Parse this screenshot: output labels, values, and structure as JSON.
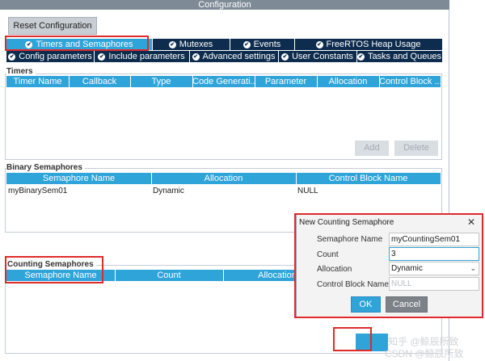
{
  "window": {
    "title": "Configuration"
  },
  "toolbar": {
    "reset_label": "Reset Configuration"
  },
  "tabs_row1": [
    {
      "label": "Timers and Semaphores",
      "active": true
    },
    {
      "label": "Mutexes"
    },
    {
      "label": "Events"
    },
    {
      "label": "FreeRTOS Heap Usage"
    }
  ],
  "tabs_row2": [
    {
      "label": "Config parameters"
    },
    {
      "label": "Include parameters"
    },
    {
      "label": "Advanced settings"
    },
    {
      "label": "User Constants"
    },
    {
      "label": "Tasks and Queues"
    }
  ],
  "timers": {
    "section_label": "Timers",
    "columns": [
      "Timer Name",
      "Callback",
      "Type",
      "Code Generati...",
      "Parameter",
      "Allocation",
      "Control Block ..."
    ],
    "add_label": "Add",
    "delete_label": "Delete"
  },
  "binary": {
    "section_label": "Binary Semaphores",
    "columns": [
      "Semaphore Name",
      "Allocation",
      "Control Block Name"
    ],
    "rows": [
      [
        "myBinarySem01",
        "Dynamic",
        "NULL"
      ]
    ]
  },
  "counting": {
    "section_label": "Counting Semaphores",
    "columns": [
      "Semaphore Name",
      "Count",
      "Allocation"
    ]
  },
  "dialog": {
    "title": "New Counting Semaphore",
    "close_glyph": "✕",
    "fields": [
      {
        "label": "Semaphore Name",
        "value": "myCountingSem01"
      },
      {
        "label": "Count",
        "value": "3"
      },
      {
        "label": "Allocation",
        "value": "Dynamic"
      },
      {
        "label": "Control Block Name",
        "placeholder": "NULL"
      }
    ],
    "ok_label": "OK",
    "cancel_label": "Cancel"
  },
  "watermark": {
    "line1": "知乎 @鲸辰所致",
    "line2": "CSDN @鲸辰所致"
  }
}
